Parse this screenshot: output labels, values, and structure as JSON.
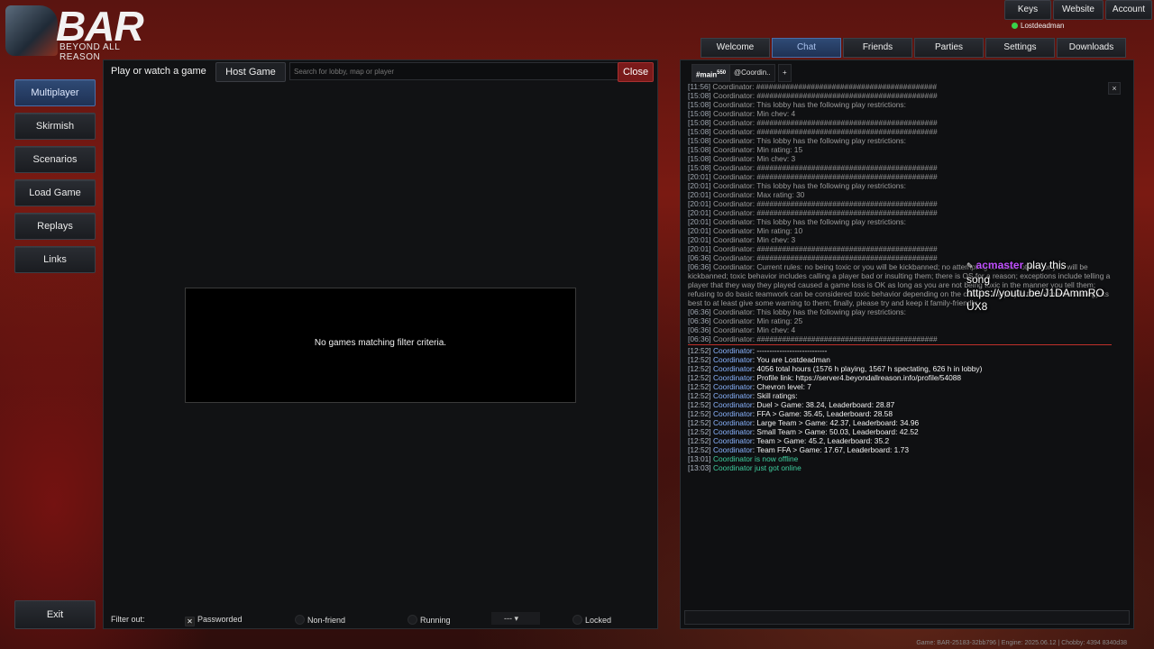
{
  "logo": {
    "title": "BAR",
    "subtitle": "BEYOND ALL REASON"
  },
  "left_menu": [
    {
      "label": "Multiplayer",
      "active": true
    },
    {
      "label": "Skirmish"
    },
    {
      "label": "Scenarios"
    },
    {
      "label": "Load Game"
    },
    {
      "label": "Replays"
    },
    {
      "label": "Links"
    }
  ],
  "exit_label": "Exit",
  "lobby": {
    "title": "Play or watch a game",
    "host_label": "Host Game",
    "search_placeholder": "Search for lobby, map or player",
    "close_label": "Close",
    "empty_text": "No games matching filter criteria.",
    "filter_label": "Filter out:",
    "filters": {
      "passworded": "Passworded",
      "non_friend": "Non-friend",
      "running": "Running",
      "dropdown": "---",
      "locked": "Locked"
    }
  },
  "top_buttons": {
    "keys": "Keys",
    "website": "Website",
    "account": "Account"
  },
  "user": {
    "name": "Lostdeadman"
  },
  "nav_tabs": [
    {
      "label": "Welcome"
    },
    {
      "label": "Chat",
      "active": true
    },
    {
      "label": "Friends"
    },
    {
      "label": "Parties"
    },
    {
      "label": "Settings"
    },
    {
      "label": "Downloads"
    }
  ],
  "chat": {
    "channel_tabs": {
      "main": "#main",
      "badge": "550",
      "coord": "@Coordin..",
      "add": "+"
    },
    "close": "×",
    "old_messages": [
      [
        "[11:56]",
        "Coordinator: ###########################################"
      ],
      [
        "[15:08]",
        "Coordinator: ###########################################"
      ],
      [
        "[15:08]",
        "Coordinator: This lobby has the following play restrictions:"
      ],
      [
        "[15:08]",
        "Coordinator: Min chev: 4"
      ],
      [
        "[15:08]",
        "Coordinator: ###########################################"
      ],
      [
        "[15:08]",
        "Coordinator: ###########################################"
      ],
      [
        "[15:08]",
        "Coordinator: This lobby has the following play restrictions:"
      ],
      [
        "[15:08]",
        "Coordinator: Min rating: 15"
      ],
      [
        "[15:08]",
        "Coordinator: Min chev: 3"
      ],
      [
        "[15:08]",
        "Coordinator: ###########################################"
      ],
      [
        "[20:01]",
        "Coordinator: ###########################################"
      ],
      [
        "[20:01]",
        "Coordinator: This lobby has the following play restrictions:"
      ],
      [
        "[20:01]",
        "Coordinator: Max rating: 30"
      ],
      [
        "[20:01]",
        "Coordinator: ###########################################"
      ],
      [
        "[20:01]",
        "Coordinator: ###########################################"
      ],
      [
        "[20:01]",
        "Coordinator: This lobby has the following play restrictions:"
      ],
      [
        "[20:01]",
        "Coordinator: Min rating: 10"
      ],
      [
        "[20:01]",
        "Coordinator: Min chev: 3"
      ],
      [
        "[20:01]",
        "Coordinator: ###########################################"
      ],
      [
        "[06:36]",
        "Coordinator: ###########################################"
      ]
    ],
    "rules_message": {
      "ts": "[06:36]",
      "text": "Coordinator: Current rules: no being toxic or you will be kickbanned; no attempting to abuse others or you will be kickbanned; toxic behavior includes calling a player bad or insulting them; there is OS for a reason; exceptions include telling a player that they way they played caused a game loss is OK as long as you are not being toxic in the manner you tell them; refusing to do basic teamwork can be considered toxic behavior depending on the context; if a player tries a meme strategy its best to at least give some warning to them; finally, please try and keep it family-friendly."
    },
    "old_messages_2": [
      [
        "[06:36]",
        "Coordinator: This lobby has the following play restrictions:"
      ],
      [
        "[06:36]",
        "Coordinator: Min rating: 25"
      ],
      [
        "[06:36]",
        "Coordinator: Min chev: 4"
      ],
      [
        "[06:36]",
        "Coordinator: ###########################################"
      ]
    ],
    "new_messages": [
      [
        "[12:52]",
        "Coordinator",
        ": ----------------------------"
      ],
      [
        "[12:52]",
        "Coordinator",
        ": You are Lostdeadman"
      ],
      [
        "[12:52]",
        "Coordinator",
        ": 4056 total hours (1576 h playing, 1567 h spectating, 626 h in lobby)"
      ],
      [
        "[12:52]",
        "Coordinator",
        ": Profile link: https://server4.beyondallreason.info/profile/54088"
      ],
      [
        "[12:52]",
        "Coordinator",
        ": Chevron level: 7"
      ],
      [
        "[12:52]",
        "Coordinator",
        ": Skill ratings:"
      ],
      [
        "[12:52]",
        "Coordinator",
        ": Duel > Game: 38.24, Leaderboard: 28.87"
      ],
      [
        "[12:52]",
        "Coordinator",
        ": FFA > Game: 35.45, Leaderboard: 28.58"
      ],
      [
        "[12:52]",
        "Coordinator",
        ": Large Team > Game: 42.37, Leaderboard: 34.96"
      ],
      [
        "[12:52]",
        "Coordinator",
        ": Small Team > Game: 50.03, Leaderboard: 42.52"
      ],
      [
        "[12:52]",
        "Coordinator",
        ": Team > Game: 45.2, Leaderboard: 35.2"
      ],
      [
        "[12:52]",
        "Coordinator",
        ": Team FFA > Game: 17.67, Leaderboard: 1.73"
      ]
    ],
    "status_messages": [
      [
        "[13:01]",
        "Coordinator",
        " is now offline"
      ],
      [
        "[13:03]",
        "Coordinator",
        " just got online"
      ]
    ]
  },
  "overlay": {
    "name": "acmaster",
    "line1": "play this",
    "line2": "song",
    "line3": "https://youtu.be/J1DAmmRO",
    "line4": "UX8"
  },
  "footer": "Game: BAR-25183-32bb796 | Engine: 2025.06.12 | Chobby: 4394 8340d38"
}
